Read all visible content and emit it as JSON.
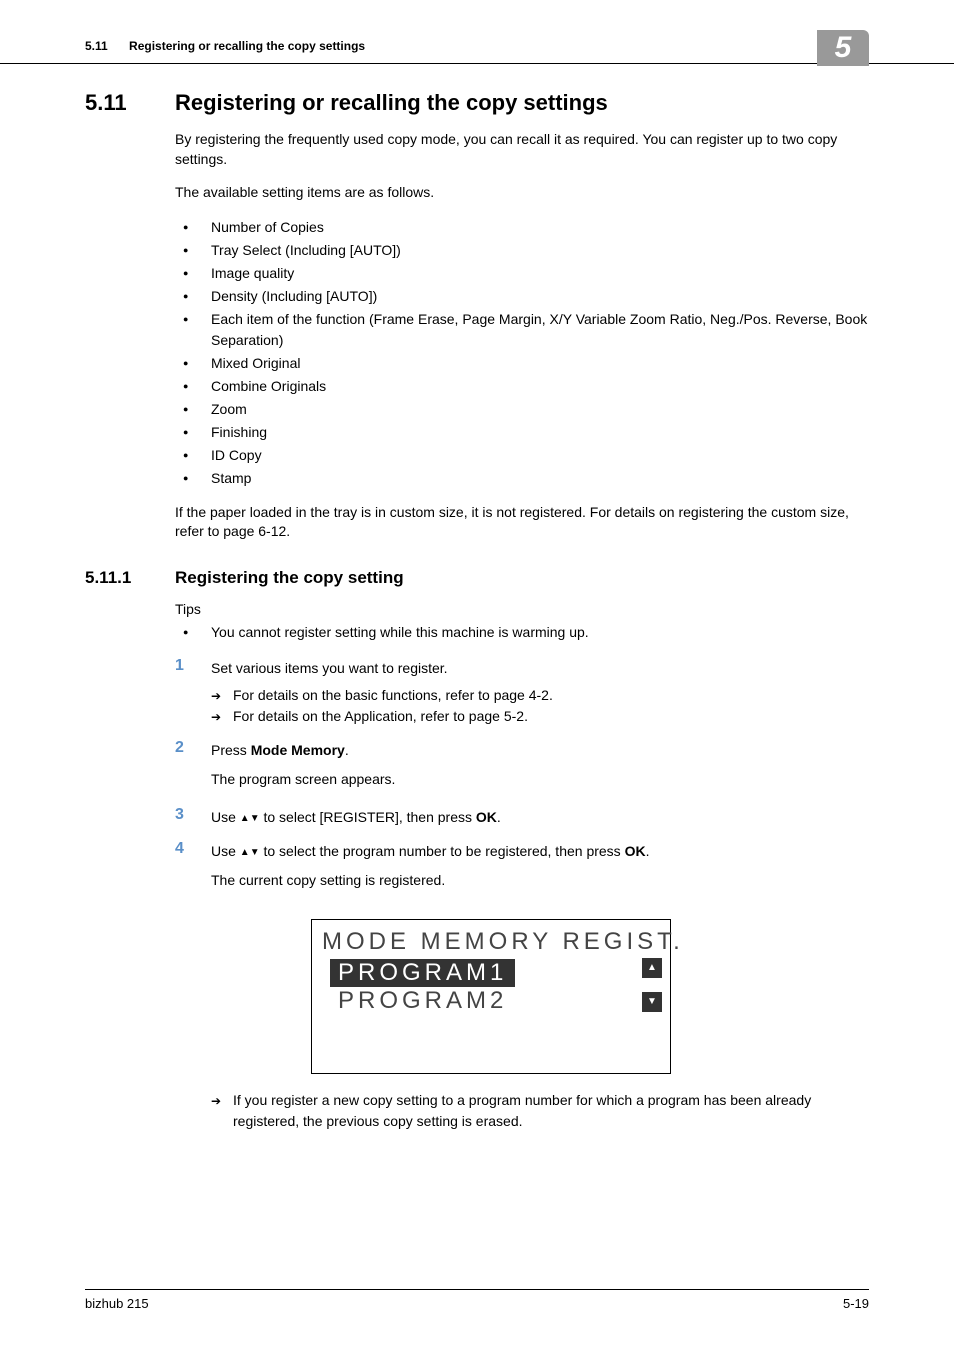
{
  "header": {
    "section_num": "5.11",
    "section_title": "Registering or recalling the copy settings",
    "chapter_num": "5"
  },
  "section": {
    "num": "5.11",
    "title": "Registering or recalling the copy settings",
    "intro": "By registering the frequently used copy mode, you can recall it as required. You can register up to two copy settings.",
    "available_line": "The available setting items are as follows.",
    "items": [
      "Number of Copies",
      "Tray Select (Including [AUTO])",
      "Image quality",
      "Density (Including [AUTO])",
      "Each item of the function (Frame Erase, Page Margin, X/Y Variable Zoom Ratio, Neg./Pos. Reverse, Book Separation)",
      "Mixed Original",
      "Combine Originals",
      "Zoom",
      "Finishing",
      "ID Copy",
      "Stamp"
    ],
    "note": "If the paper loaded in the tray is in custom size, it is not registered. For details on registering the custom size, refer to page 6-12."
  },
  "subsection": {
    "num": "5.11.1",
    "title": "Registering the copy setting",
    "tips_label": "Tips",
    "tips": [
      "You cannot register setting while this machine is warming up."
    ],
    "steps": [
      {
        "n": "1",
        "text": "Set various items you want to register.",
        "arrows": [
          "For details on the basic functions, refer to page 4-2.",
          "For details on the Application, refer to page 5-2."
        ]
      },
      {
        "n": "2",
        "text_pre": "Press ",
        "bold": "Mode Memory",
        "text_post": ".",
        "result": "The program screen appears."
      },
      {
        "n": "3",
        "text_pre": "Use ",
        "text_mid": " to select [REGISTER], then press ",
        "bold": "OK",
        "text_post": "."
      },
      {
        "n": "4",
        "text_pre": "Use ",
        "text_mid": " to select the program number to be registered, then press ",
        "bold": "OK",
        "text_post": ".",
        "result": "The current copy setting is registered."
      }
    ],
    "screen": {
      "title": "MODE MEMORY REGIST.",
      "selected": "PROGRAM1",
      "option2": "PROGRAM2"
    },
    "arrow_note": "If you register a new copy setting to a program number for which a program has been already registered, the previous copy setting is erased."
  },
  "footer": {
    "left": "bizhub 215",
    "right": "5-19"
  }
}
